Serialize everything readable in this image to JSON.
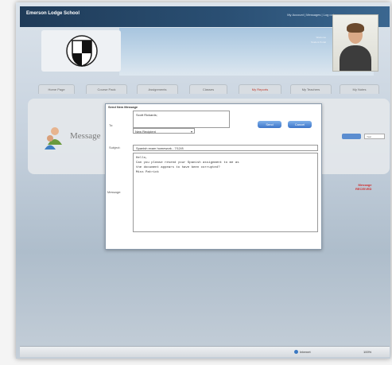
{
  "header": {
    "school_name": "Emerson Lodge School",
    "top_info": "My Account | Messages | Log out"
  },
  "profile": {
    "line1": "Welcome",
    "line2": "Student Portal"
  },
  "tabs": [
    {
      "label": "Home Page",
      "highlight": false
    },
    {
      "label": "Course Pack",
      "highlight": false
    },
    {
      "label": "Assignments",
      "highlight": false
    },
    {
      "label": "Classes",
      "highlight": false
    },
    {
      "label": "My Reports",
      "highlight": true
    },
    {
      "label": "My Teachers",
      "highlight": false
    },
    {
      "label": "My Notes",
      "highlight": false
    }
  ],
  "main": {
    "heading": "Message",
    "side_field": "Year",
    "red_note_1": "Message",
    "red_note_2": "RECEIVED"
  },
  "dialog": {
    "title": "Send New Message",
    "to_label": "To:",
    "to_value": "Scott Rickards;",
    "select_value": "New Recipient",
    "send_label": "Send",
    "cancel_label": "Cancel",
    "subject_label": "Subject:",
    "subject_value": "Spanish exam homework - 7/12/8",
    "message_label": "Message:",
    "message_lines": [
      "Hello,",
      "",
      "Can you please resend your Spanish assignment to me as",
      "the document appears to have been corrupted?",
      "",
      "",
      "Miss Patrick"
    ]
  },
  "status": {
    "zone": "Internet",
    "zoom": "100%"
  },
  "colors": {
    "brand_dark": "#1f3b58",
    "accent_blue": "#3c74c8",
    "alert_red": "#d03030"
  }
}
